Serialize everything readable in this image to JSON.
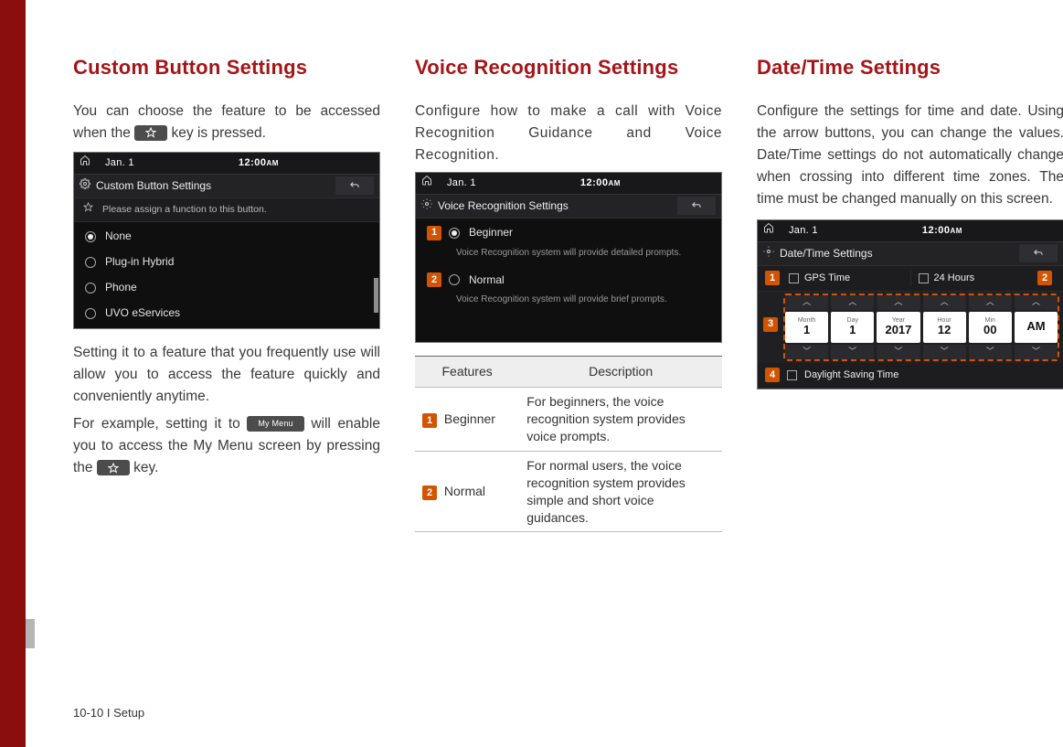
{
  "page_footer": "10-10 I Setup",
  "col1": {
    "heading": "Custom Button Settings",
    "p1a": "You can choose the feature to be accessed when the ",
    "p1b": " key is pressed.",
    "p2": "Setting it to a feature that you frequently use will allow you to access the feature quickly and conveniently anytime.",
    "p3a": "For example, setting it to ",
    "p3_key": "My Menu",
    "p3b": " will enable you to access the My Menu screen by pressing the ",
    "p3c": " key."
  },
  "scr1": {
    "date": "Jan. 1",
    "time": "12:00",
    "ampm": "AM",
    "title": "Custom Button Settings",
    "note": "Please assign a function to this button.",
    "options": [
      "None",
      "Plug-in Hybrid",
      "Phone",
      "UVO eServices"
    ],
    "selected_index": 0
  },
  "col2": {
    "heading": "Voice Recognition Settings",
    "p1": "Configure how to make a call with Voice Recognition Guidance and Voice Recognition."
  },
  "scr2": {
    "date": "Jan. 1",
    "time": "12:00",
    "ampm": "AM",
    "title": "Voice Recognition Settings",
    "items": [
      {
        "num": "1",
        "label": "Beginner",
        "sub": "Voice Recognition system will provide detailed prompts.",
        "selected": true
      },
      {
        "num": "2",
        "label": "Normal",
        "sub": "Voice Recognition system will provide brief prompts.",
        "selected": false
      }
    ]
  },
  "table2": {
    "head_features": "Features",
    "head_desc": "Description",
    "rows": [
      {
        "num": "1",
        "feature": "Beginner",
        "desc": "For beginners, the voice recognition system provides voice prompts."
      },
      {
        "num": "2",
        "feature": "Normal",
        "desc": "For normal users, the voice recognition system provides simple and short voice guidances."
      }
    ]
  },
  "col3": {
    "heading": "Date/Time Settings",
    "p1": "Configure the settings for time and date. Using the arrow buttons, you can change the values. Date/Time settings do not automatically change when crossing into different time zones. The time must be changed manually on this screen."
  },
  "scr3": {
    "date": "Jan. 1",
    "time": "12:00",
    "ampm": "AM",
    "title": "Date/Time Settings",
    "gps_label": "GPS Time",
    "hours24_label": "24 Hours",
    "dst_label": "Daylight Saving Time",
    "nums": {
      "gps": "1",
      "hours24": "2",
      "grid": "3",
      "dst": "4"
    },
    "cols": [
      {
        "label": "Month",
        "value": "1"
      },
      {
        "label": "Day",
        "value": "1"
      },
      {
        "label": "Year",
        "value": "2017"
      },
      {
        "label": "Hour",
        "value": "12"
      },
      {
        "label": "Min",
        "value": "00"
      },
      {
        "label": "",
        "value": "AM"
      }
    ]
  }
}
